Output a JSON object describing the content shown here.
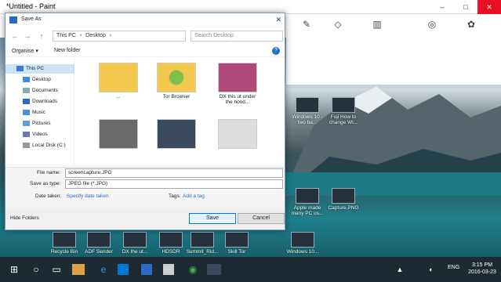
{
  "window": {
    "title": "*Untitled - Paint",
    "minimize": "–",
    "maximize": "□",
    "close": "✕"
  },
  "dialog": {
    "title": "Save As",
    "close": "✕",
    "address": {
      "back": "←",
      "forward": "→",
      "up": "↑",
      "crumbs": [
        "This PC",
        "›",
        "Desktop",
        "›"
      ],
      "search_placeholder": "Search Desktop"
    },
    "cmd": {
      "organise": "Organise ▾",
      "new_folder": "New folder",
      "help": "?"
    },
    "nav": [
      {
        "label": "This PC",
        "selected": true
      },
      {
        "label": "Desktop",
        "selected": false
      },
      {
        "label": "Documents",
        "selected": false
      },
      {
        "label": "Downloads",
        "selected": false
      },
      {
        "label": "Music",
        "selected": false
      },
      {
        "label": "Pictures",
        "selected": false
      },
      {
        "label": "Videos",
        "selected": false
      },
      {
        "label": "Local Disk (C:)",
        "selected": false
      }
    ],
    "files": [
      {
        "name": "..."
      },
      {
        "name": "Tor Browser"
      },
      {
        "name": "DX this ut under the hood..."
      },
      {
        "name": ""
      },
      {
        "name": ""
      },
      {
        "name": ""
      }
    ],
    "form": {
      "filename_label": "File name:",
      "filename_value": "screencapture.JPG",
      "type_label": "Save as type:",
      "type_value": "JPEG file (*.JPG)",
      "date_label": "Date taken:",
      "date_value": "Specify date taken",
      "tags_label": "Tags:",
      "tags_value": "Add a tag"
    },
    "footer": {
      "hide": "Hide Folders",
      "save": "Save",
      "cancel": "Cancel"
    }
  },
  "desktop_icons": [
    {
      "label": "Windows 10 - two ba..."
    },
    {
      "label": "Fuji How to change Wi..."
    },
    {
      "label": "Apple made many PC us..."
    },
    {
      "label": "Capture.PNG"
    },
    {
      "label": "Recycle Bin"
    },
    {
      "label": "ADF Sender"
    },
    {
      "label": "DX the ut..."
    },
    {
      "label": "HDSDR"
    },
    {
      "label": "Summit_Rid..."
    },
    {
      "label": "Skill Tor"
    },
    {
      "label": "Windows 10..."
    }
  ],
  "taskbar": {
    "start": "⊞",
    "search": "○",
    "taskview": "▭",
    "lang": "ENG",
    "time": "3:15 PM",
    "date": "2016-03-23"
  }
}
